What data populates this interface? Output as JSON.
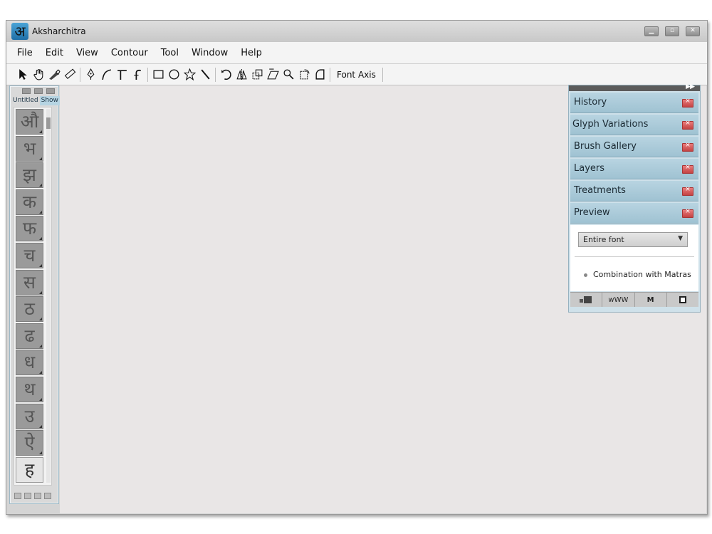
{
  "window": {
    "title": "Aksharchitra",
    "logo_glyph": "अ"
  },
  "menubar": {
    "items": [
      {
        "label": "File"
      },
      {
        "label": "Edit"
      },
      {
        "label": "View"
      },
      {
        "label": "Contour"
      },
      {
        "label": "Tool"
      },
      {
        "label": "Window"
      },
      {
        "label": "Help"
      }
    ]
  },
  "toolbar": {
    "font_axis_label": "Font Axis",
    "tools": [
      "pointer-arrow-icon",
      "hand-pan-icon",
      "knife-icon",
      "ruler-icon",
      "pen-nib-icon",
      "curve-tool-icon",
      "corner-point-icon",
      "tangent-point-icon",
      "rectangle-icon",
      "ellipse-icon",
      "star-icon",
      "line-tool-icon",
      "rotate-icon",
      "mirror-icon",
      "scale-icon",
      "skew-icon",
      "zoom-icon",
      "transform-icon",
      "rounded-corner-icon"
    ]
  },
  "glyph_panel": {
    "tab_untitled": "Untitled",
    "tab_show": "Show",
    "glyphs": [
      "औ",
      "भ",
      "झ",
      "क",
      "फ",
      "च",
      "स",
      "ठ",
      "ढ",
      "ध",
      "थ",
      "उ",
      "ऐ",
      "ह"
    ],
    "selected_index": 13
  },
  "panels": {
    "items": [
      {
        "label": "History"
      },
      {
        "label": "Glyph Variations"
      },
      {
        "label": "Brush Gallery"
      },
      {
        "label": "Layers"
      },
      {
        "label": "Treatments"
      },
      {
        "label": "Preview"
      }
    ],
    "preview": {
      "select_value": "Entire font",
      "option_label": "Combination with Matras",
      "tools": [
        "text-block-icon",
        "www",
        "M",
        "frame-icon"
      ],
      "tool_www": "wWW",
      "tool_m": "M"
    }
  },
  "colors": {
    "panel_blue": "#9fc2d2",
    "canvas": "#e9e6e6",
    "close_red": "#c44343"
  }
}
